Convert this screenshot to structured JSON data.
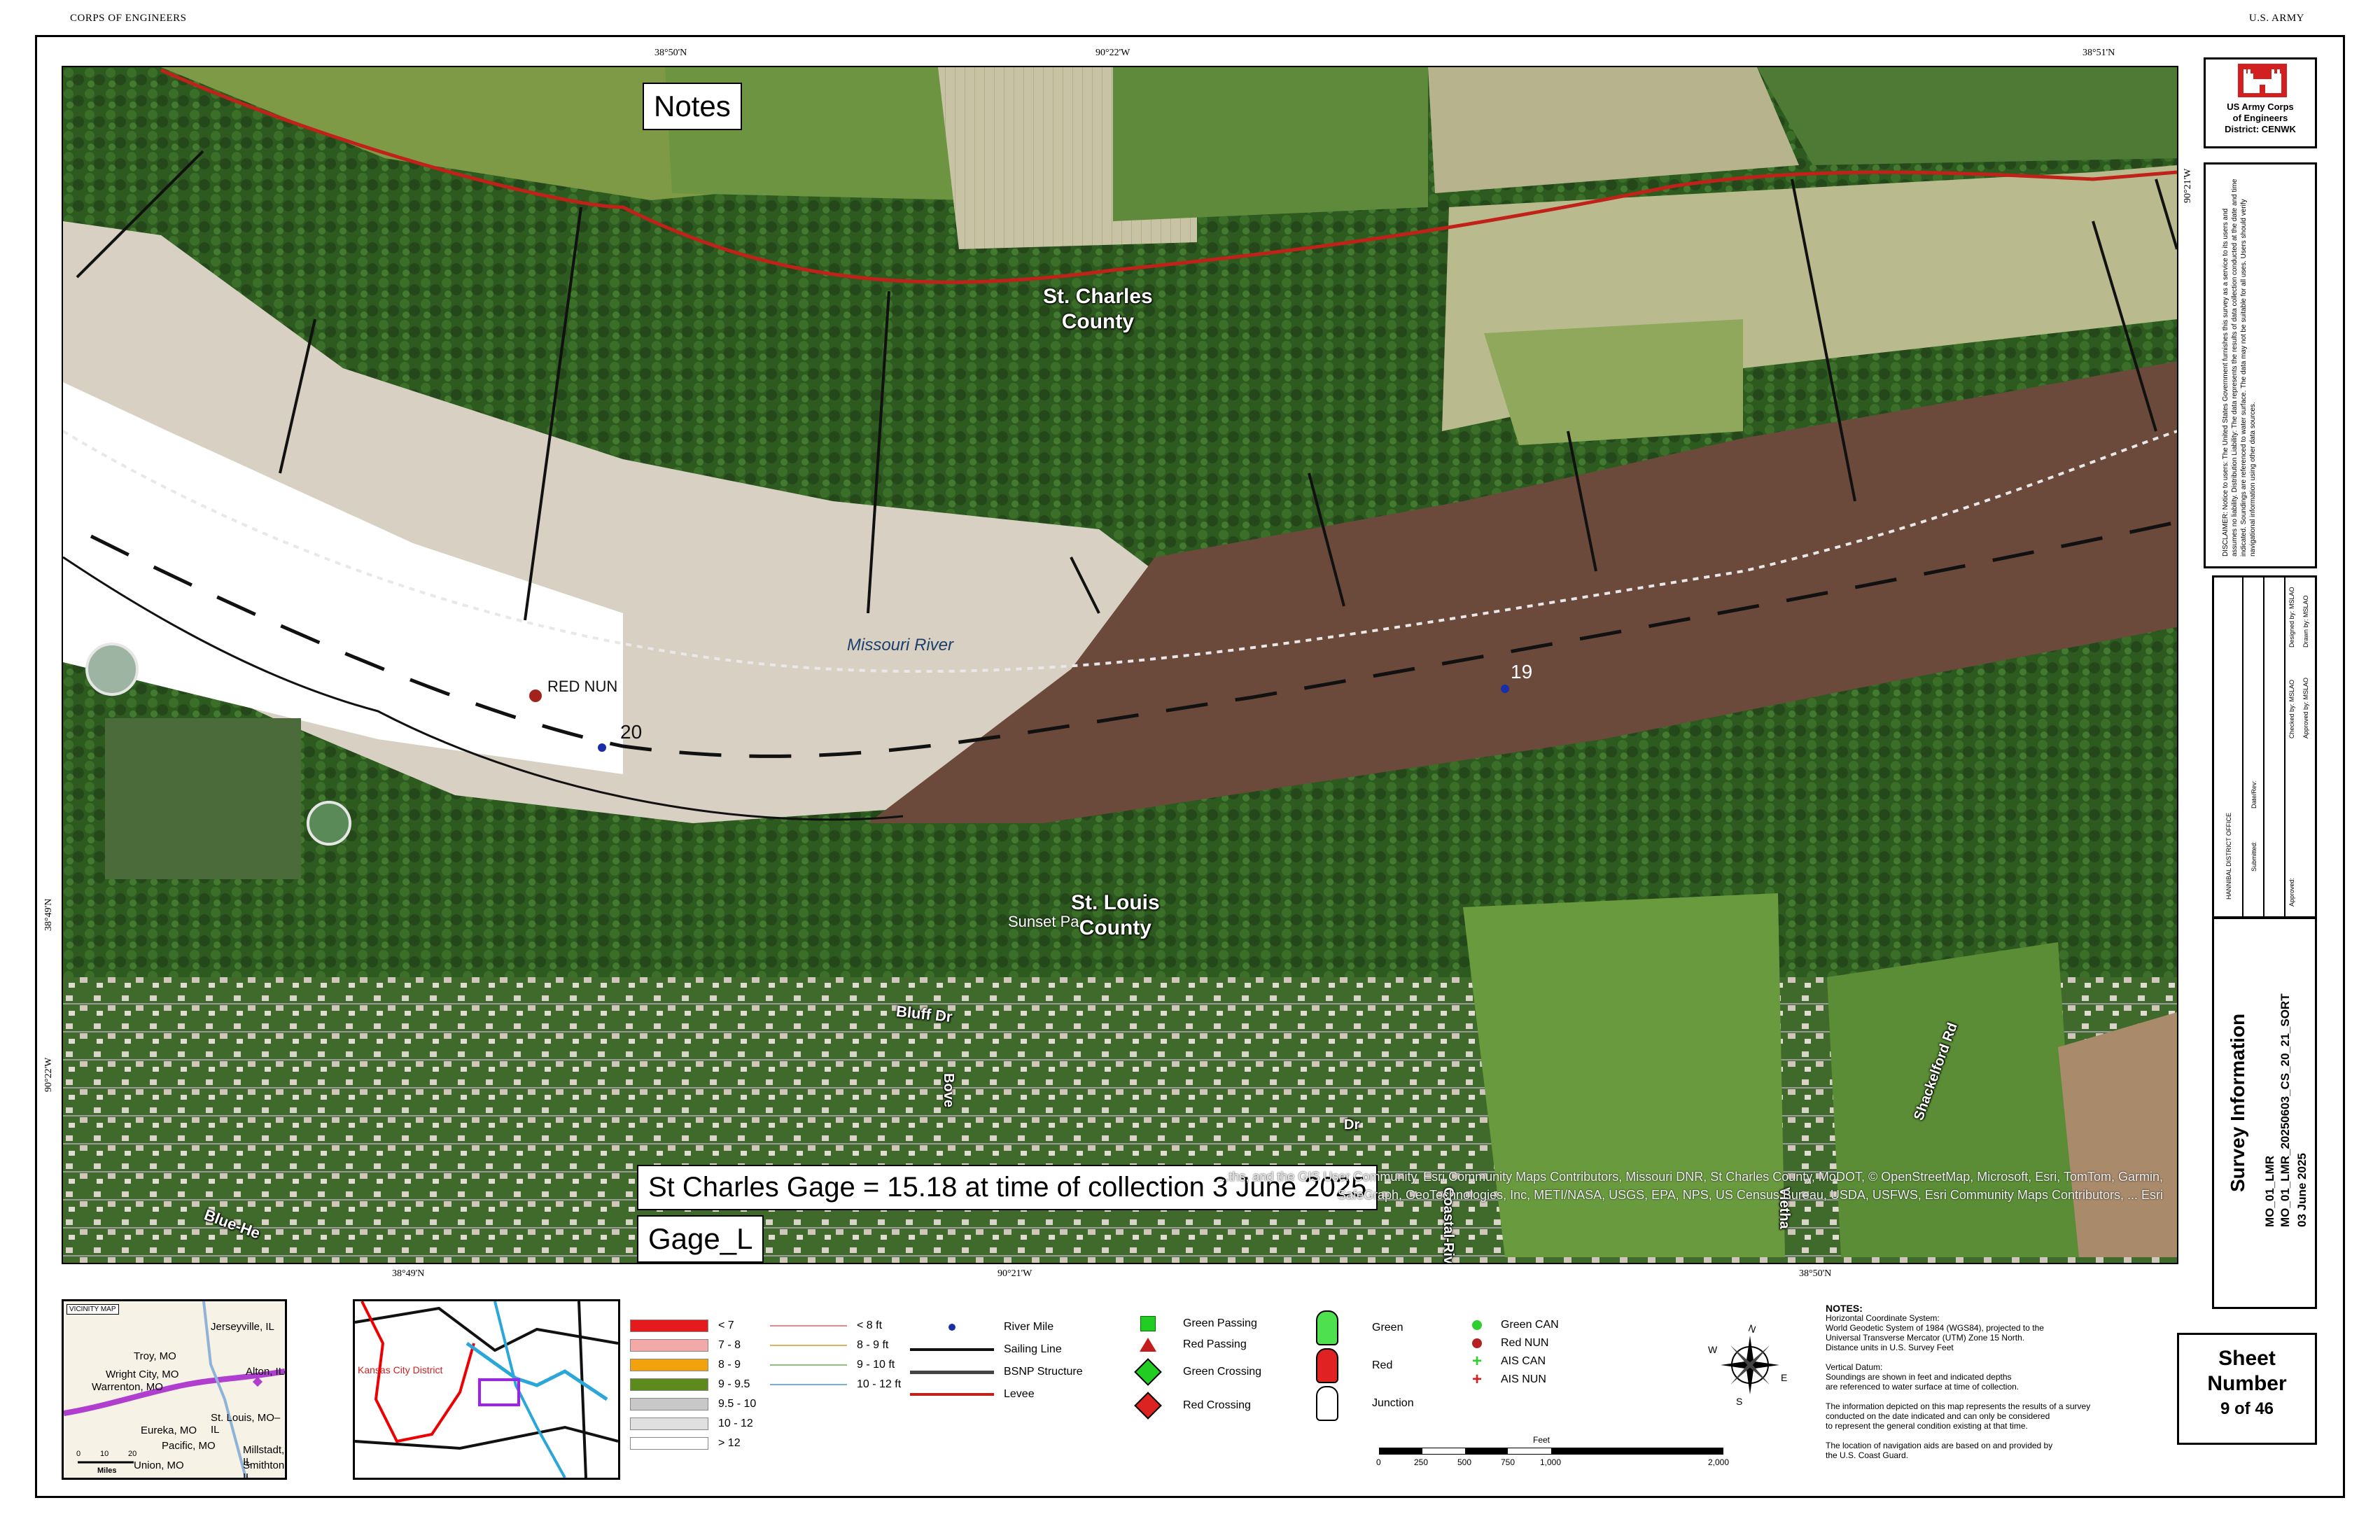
{
  "header": {
    "left": "CORPS OF ENGINEERS",
    "right": "U.S. ARMY"
  },
  "coords": {
    "top": [
      "38°50'N",
      "90°22'W",
      "38°51'N"
    ],
    "bottom": [
      "38°49'N",
      "90°21'W",
      "38°50'N"
    ],
    "left": [
      "38°49'N",
      "90°22'W"
    ],
    "right": [
      "90°21'W"
    ]
  },
  "map": {
    "notes_label": "Notes",
    "gage_label": "St Charles Gage = 15.18 at time of collection 3 June 2025",
    "gage_l_label": "Gage_L",
    "county_north": "St. Charles\nCounty",
    "county_south": "St. Louis\nCounty",
    "river_label": "Missouri River",
    "red_nun": "RED NUN",
    "mile_20": "20",
    "mile_19": "19",
    "sunset_park": "Sunset Pa",
    "bluff_dr": "Bluff Dr",
    "roads": [
      "Dr",
      "Bove",
      "Blue-He",
      "Coastal-River",
      "Vietha",
      "Shackelford Rd"
    ],
    "attribution": "...ths, and the GIS User Community, Esri Community Maps Contributors, Missouri DNR, St Charles County, MoDOT, © OpenStreetMap, Microsoft, Esri, TomTom, Garmin, SafeGraph, GeoTechnologies, Inc, METI/NASA, USGS, EPA, NPS, US Census Bureau, USDA, USFWS, Esri Community Maps Contributors, ... Esri"
  },
  "usace": {
    "logo_name": "US Army Corps of Engineers",
    "district": "District: CENWK",
    "title_lines": [
      "US Army Corps",
      "of Engineers",
      "District: CENWK"
    ]
  },
  "disclaimer": "DISCLAIMER: Notice to users: The United States Government furnishes this survey as a service to its users and assumes no liability. Distribution Liability: The data represents the results of data collection conducted at the date and time indicated. Soundings are referenced to water surface. The data may not be suitable for all uses. Users should verify navigational information using other data sources.",
  "signature_block": {
    "rows": [
      "Designed by: MSLAO",
      "Drawn by: MSLAO",
      "Checked by: MSLAO",
      "Approved by: MSLAO"
    ],
    "title": "HANNIBAL DISTRICT OFFICE",
    "fields": [
      "Date/Rev:",
      "Submitted:",
      "Approved:"
    ]
  },
  "survey": {
    "title": "Survey Information",
    "file": "MO_01_LMR",
    "file2": "MO_01_LMR_20250603_CS_20_21_SORT",
    "date": "03 June 2025"
  },
  "sheet": {
    "line1": "Sheet",
    "line2": "Number",
    "line3": "9 of 46"
  },
  "vicinity": {
    "title": "VICINITY MAP",
    "places": [
      "Jerseyville, IL",
      "Troy, MO",
      "Wright City, MO",
      "Warrenton, MO",
      "Alton, IL–MO",
      "Eureka, MO",
      "St. Louis, MO–IL",
      "Pacific, MO",
      "Union, MO",
      "Millstadt, IL",
      "Smithton, IL"
    ],
    "scale_ticks": [
      "0",
      "10",
      "20"
    ],
    "scale_unit": "Miles"
  },
  "overview": {
    "district_label": "Kansas City District"
  },
  "depth_legend": [
    {
      "label": "< 7",
      "color": "#e41a1c"
    },
    {
      "label": "7 - 8",
      "color": "#f4a9a9"
    },
    {
      "label": "8 - 9",
      "color": "#f2a20d"
    },
    {
      "label": "9 - 9.5",
      "color": "#5c8a1c"
    },
    {
      "label": "9.5 - 10",
      "color": "#c8c8c8"
    },
    {
      "label": "10 - 12",
      "color": "#e0e0e0"
    },
    {
      "label": "> 12",
      "color": "#ffffff"
    }
  ],
  "contour_legend": [
    {
      "label": "< 8 ft",
      "color": "#e98a8a"
    },
    {
      "label": "8 - 9 ft",
      "color": "#e0b060"
    },
    {
      "label": "9 - 10 ft",
      "color": "#88c47a"
    },
    {
      "label": "10 - 12 ft",
      "color": "#7ab0d8"
    }
  ],
  "line_legend": [
    "River Mile",
    "Sailing Line",
    "BSNP Structure",
    "Levee"
  ],
  "nav_legend": [
    "Green Passing",
    "Red Passing",
    "Green Crossing",
    "Red Crossing"
  ],
  "light_legend": [
    "Green",
    "Red",
    "Junction"
  ],
  "buoy_legend": [
    "Green CAN",
    "Red NUN",
    "AIS CAN",
    "AIS NUN"
  ],
  "compass": [
    "N",
    "E",
    "S",
    "W"
  ],
  "scale_bar": {
    "unit": "Feet",
    "ticks": [
      "0",
      "250",
      "500",
      "750",
      "1,000",
      "2,000"
    ]
  },
  "notes_text": {
    "heading": "NOTES:",
    "lines": [
      "Horizontal Coordinate System:",
      "World Geodetic System of 1984 (WGS84), projected to the",
      "Universal Transverse Mercator (UTM) Zone 15 North.",
      "Distance units in U.S. Survey Feet",
      "",
      "Vertical Datum:",
      "Soundings are shown in feet and indicated depths",
      "are referenced to water surface at time of collection.",
      "",
      "The information depicted on this map represents the results of a survey",
      "conducted on the date indicated and can only be considered",
      "to represent the general condition existing at that time.",
      "",
      "The location of navigation aids are based on and provided by",
      "the U.S. Coast Guard."
    ]
  },
  "colors": {
    "river": "#6b4a3c",
    "levee": "#c0221a",
    "forest": "#2f5a22",
    "field": "#8a9b56"
  }
}
